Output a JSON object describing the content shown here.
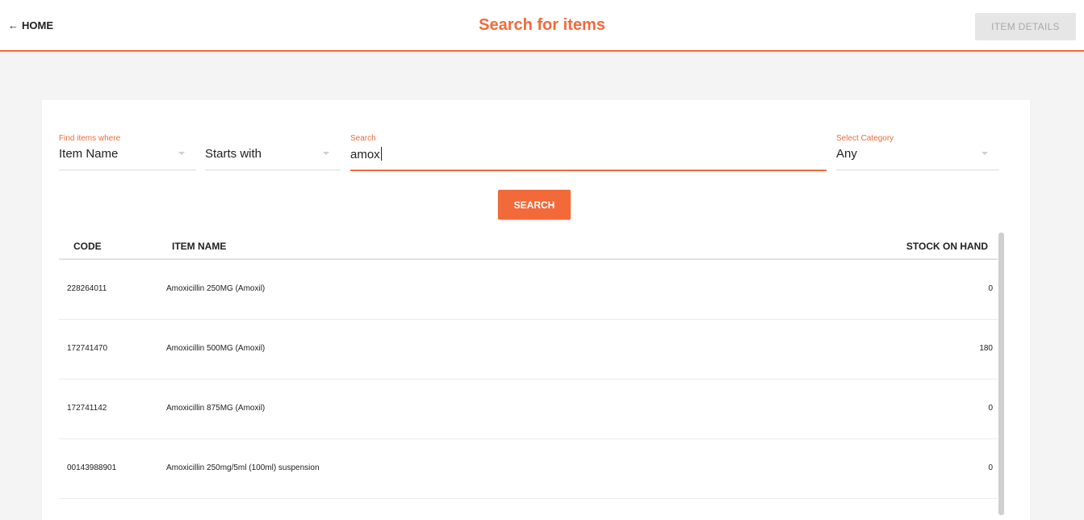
{
  "header": {
    "home_label": "HOME",
    "back_arrow": "←",
    "title": "Search for items",
    "details_button": "ITEM DETAILS"
  },
  "filters": {
    "find_label": "Find items where",
    "field_value": "Item Name",
    "operator_value": "Starts with",
    "search_label": "Search",
    "search_value": "amox",
    "category_label": "Select Category",
    "category_value": "Any",
    "search_button": "SEARCH"
  },
  "table": {
    "columns": {
      "code": "CODE",
      "name": "ITEM NAME",
      "stock": "STOCK ON HAND"
    },
    "rows": [
      {
        "code": "228264011",
        "name": "Amoxicillin 250MG (Amoxil)",
        "stock": "0"
      },
      {
        "code": "172741470",
        "name": "Amoxicillin 500MG (Amoxil)",
        "stock": "180"
      },
      {
        "code": "172741142",
        "name": "Amoxicillin 875MG (Amoxil)",
        "stock": "0"
      },
      {
        "code": "00143988901",
        "name": "Amoxicillin 250mg/5ml (100ml) suspension",
        "stock": "0"
      }
    ]
  },
  "colors": {
    "accent": "#f26a3a",
    "disabled_button": "#e6e6e6"
  }
}
